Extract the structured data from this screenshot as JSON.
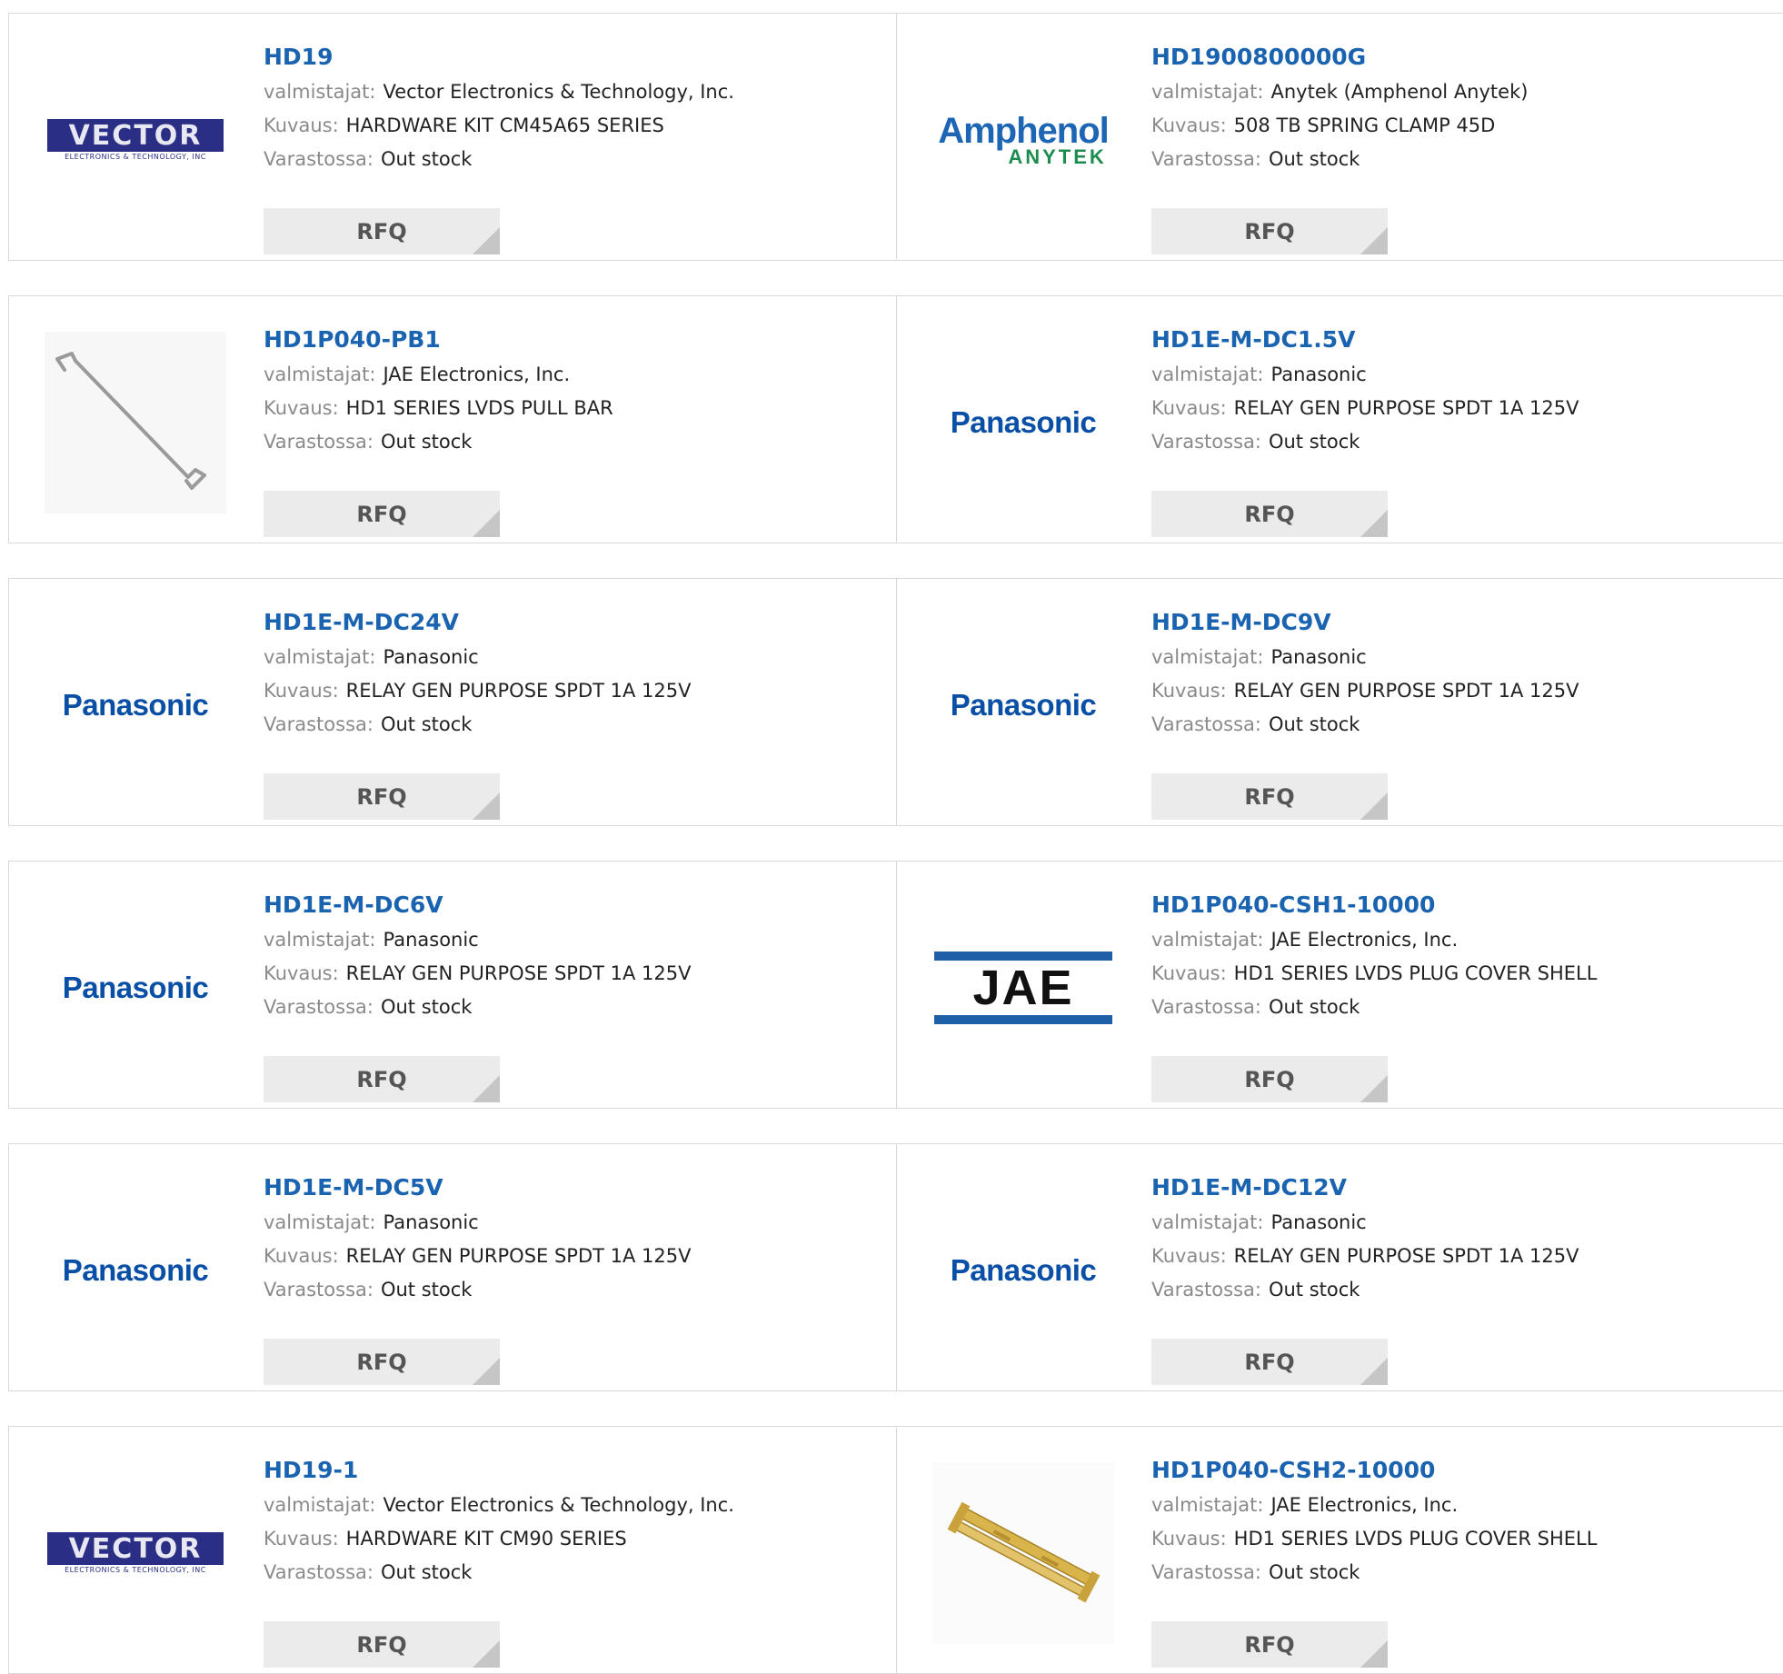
{
  "labels": {
    "manufacturer": "valmistajat:",
    "description": "Kuvaus:",
    "stock": "Varastossa:",
    "rfq": "RFQ"
  },
  "logo_text": {
    "vector": "VECTOR",
    "vector_sub": "ELECTRONICS & TECHNOLOGY, INC",
    "panasonic": "Panasonic",
    "amphenol": "Amphenol",
    "anytek": "ANYTEK",
    "jae": "JAE"
  },
  "colors": {
    "link": "#1a63b0",
    "label": "#8a8a8a",
    "border": "#d9d9d9",
    "rfq_bg": "#ebebeb"
  },
  "products": [
    {
      "part": "HD19",
      "manufacturer": "Vector Electronics & Technology, Inc.",
      "description": "HARDWARE KIT CM45A65 SERIES",
      "stock": "Out stock",
      "logo": "vector-logo"
    },
    {
      "part": "HD1900800000G",
      "manufacturer": "Anytek (Amphenol Anytek)",
      "description": "508 TB SPRING CLAMP 45D",
      "stock": "Out stock",
      "logo": "amphenol-anytek-logo"
    },
    {
      "part": "HD1P040-PB1",
      "manufacturer": "JAE Electronics, Inc.",
      "description": "HD1 SERIES LVDS PULL BAR",
      "stock": "Out stock",
      "logo": "pull-bar-image"
    },
    {
      "part": "HD1E-M-DC1.5V",
      "manufacturer": "Panasonic",
      "description": "RELAY GEN PURPOSE SPDT 1A 125V",
      "stock": "Out stock",
      "logo": "panasonic-logo"
    },
    {
      "part": "HD1E-M-DC24V",
      "manufacturer": "Panasonic",
      "description": "RELAY GEN PURPOSE SPDT 1A 125V",
      "stock": "Out stock",
      "logo": "panasonic-logo"
    },
    {
      "part": "HD1E-M-DC9V",
      "manufacturer": "Panasonic",
      "description": "RELAY GEN PURPOSE SPDT 1A 125V",
      "stock": "Out stock",
      "logo": "panasonic-logo"
    },
    {
      "part": "HD1E-M-DC6V",
      "manufacturer": "Panasonic",
      "description": "RELAY GEN PURPOSE SPDT 1A 125V",
      "stock": "Out stock",
      "logo": "panasonic-logo"
    },
    {
      "part": "HD1P040-CSH1-10000",
      "manufacturer": "JAE Electronics, Inc.",
      "description": "HD1 SERIES LVDS PLUG COVER SHELL",
      "stock": "Out stock",
      "logo": "jae-logo"
    },
    {
      "part": "HD1E-M-DC5V",
      "manufacturer": "Panasonic",
      "description": "RELAY GEN PURPOSE SPDT 1A 125V",
      "stock": "Out stock",
      "logo": "panasonic-logo"
    },
    {
      "part": "HD1E-M-DC12V",
      "manufacturer": "Panasonic",
      "description": "RELAY GEN PURPOSE SPDT 1A 125V",
      "stock": "Out stock",
      "logo": "panasonic-logo"
    },
    {
      "part": "HD19-1",
      "manufacturer": "Vector Electronics & Technology, Inc.",
      "description": "HARDWARE KIT CM90 SERIES",
      "stock": "Out stock",
      "logo": "vector-logo"
    },
    {
      "part": "HD1P040-CSH2-10000",
      "manufacturer": "JAE Electronics, Inc.",
      "description": "HD1 SERIES LVDS PLUG COVER SHELL",
      "stock": "Out stock",
      "logo": "cover-shell-image"
    }
  ]
}
